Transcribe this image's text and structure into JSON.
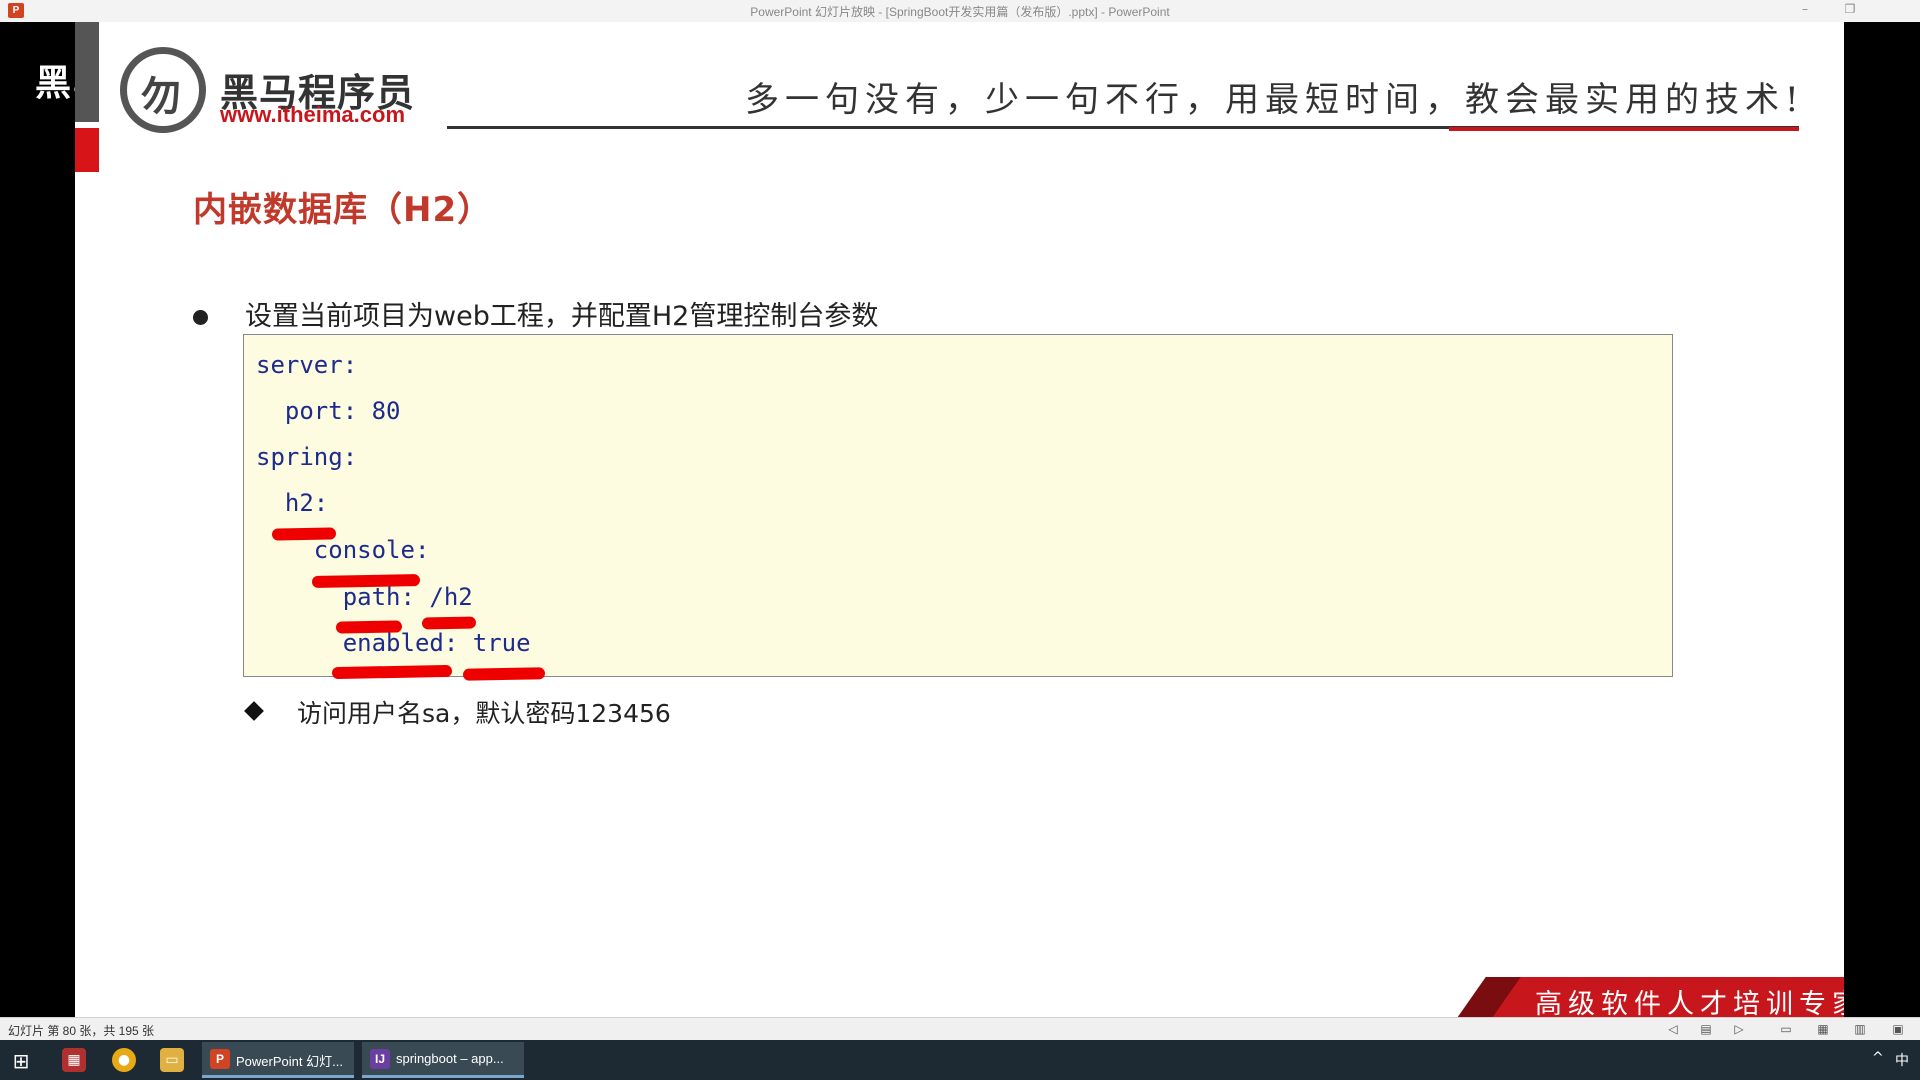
{
  "window": {
    "title": "PowerPoint 幻灯片放映 - [SpringBoot开发实用篇（发布版）.pptx] - PowerPoint",
    "app_icon": "P",
    "minimize": "–",
    "restore": "❐"
  },
  "slide": {
    "ghost_text": "黑马程序员",
    "logo": {
      "mark": "勿",
      "name": "黑马程序员",
      "url": "www.itheima.com"
    },
    "slogan": "多一句没有，少一句不行，用最短时间，教会最实用的技术!",
    "title": "内嵌数据库（H2）",
    "bullet": "设置当前项目为web工程，并配置H2管理控制台参数",
    "code_lines": [
      "server:",
      "  port: 80",
      "spring:",
      "  h2:",
      "    console:",
      "      path: /h2",
      "      enabled: true"
    ],
    "sub_bullet": "访问用户名sa，默认密码123456",
    "banner": "高级软件人才培训专家",
    "colors": {
      "title": "#c0392b",
      "code_text": "#1c2b8c",
      "code_bg": "#fdfbe0",
      "marker": "#ee0000",
      "brand_red": "#c8161d"
    }
  },
  "statusbar": {
    "slide_info": "幻灯片 第 80 张，共 195 张",
    "icons": [
      "prev-icon",
      "notes-icon",
      "next-icon",
      "normal-view-icon",
      "sorter-view-icon",
      "reading-view-icon",
      "slideshow-icon"
    ]
  },
  "taskbar": {
    "start_icon": "⊞",
    "apps": [
      {
        "icon": "P",
        "label": "PowerPoint 幻灯..."
      },
      {
        "icon": "IJ",
        "label": "springboot – app..."
      }
    ],
    "tray_chevron": "^",
    "ime": "中"
  }
}
